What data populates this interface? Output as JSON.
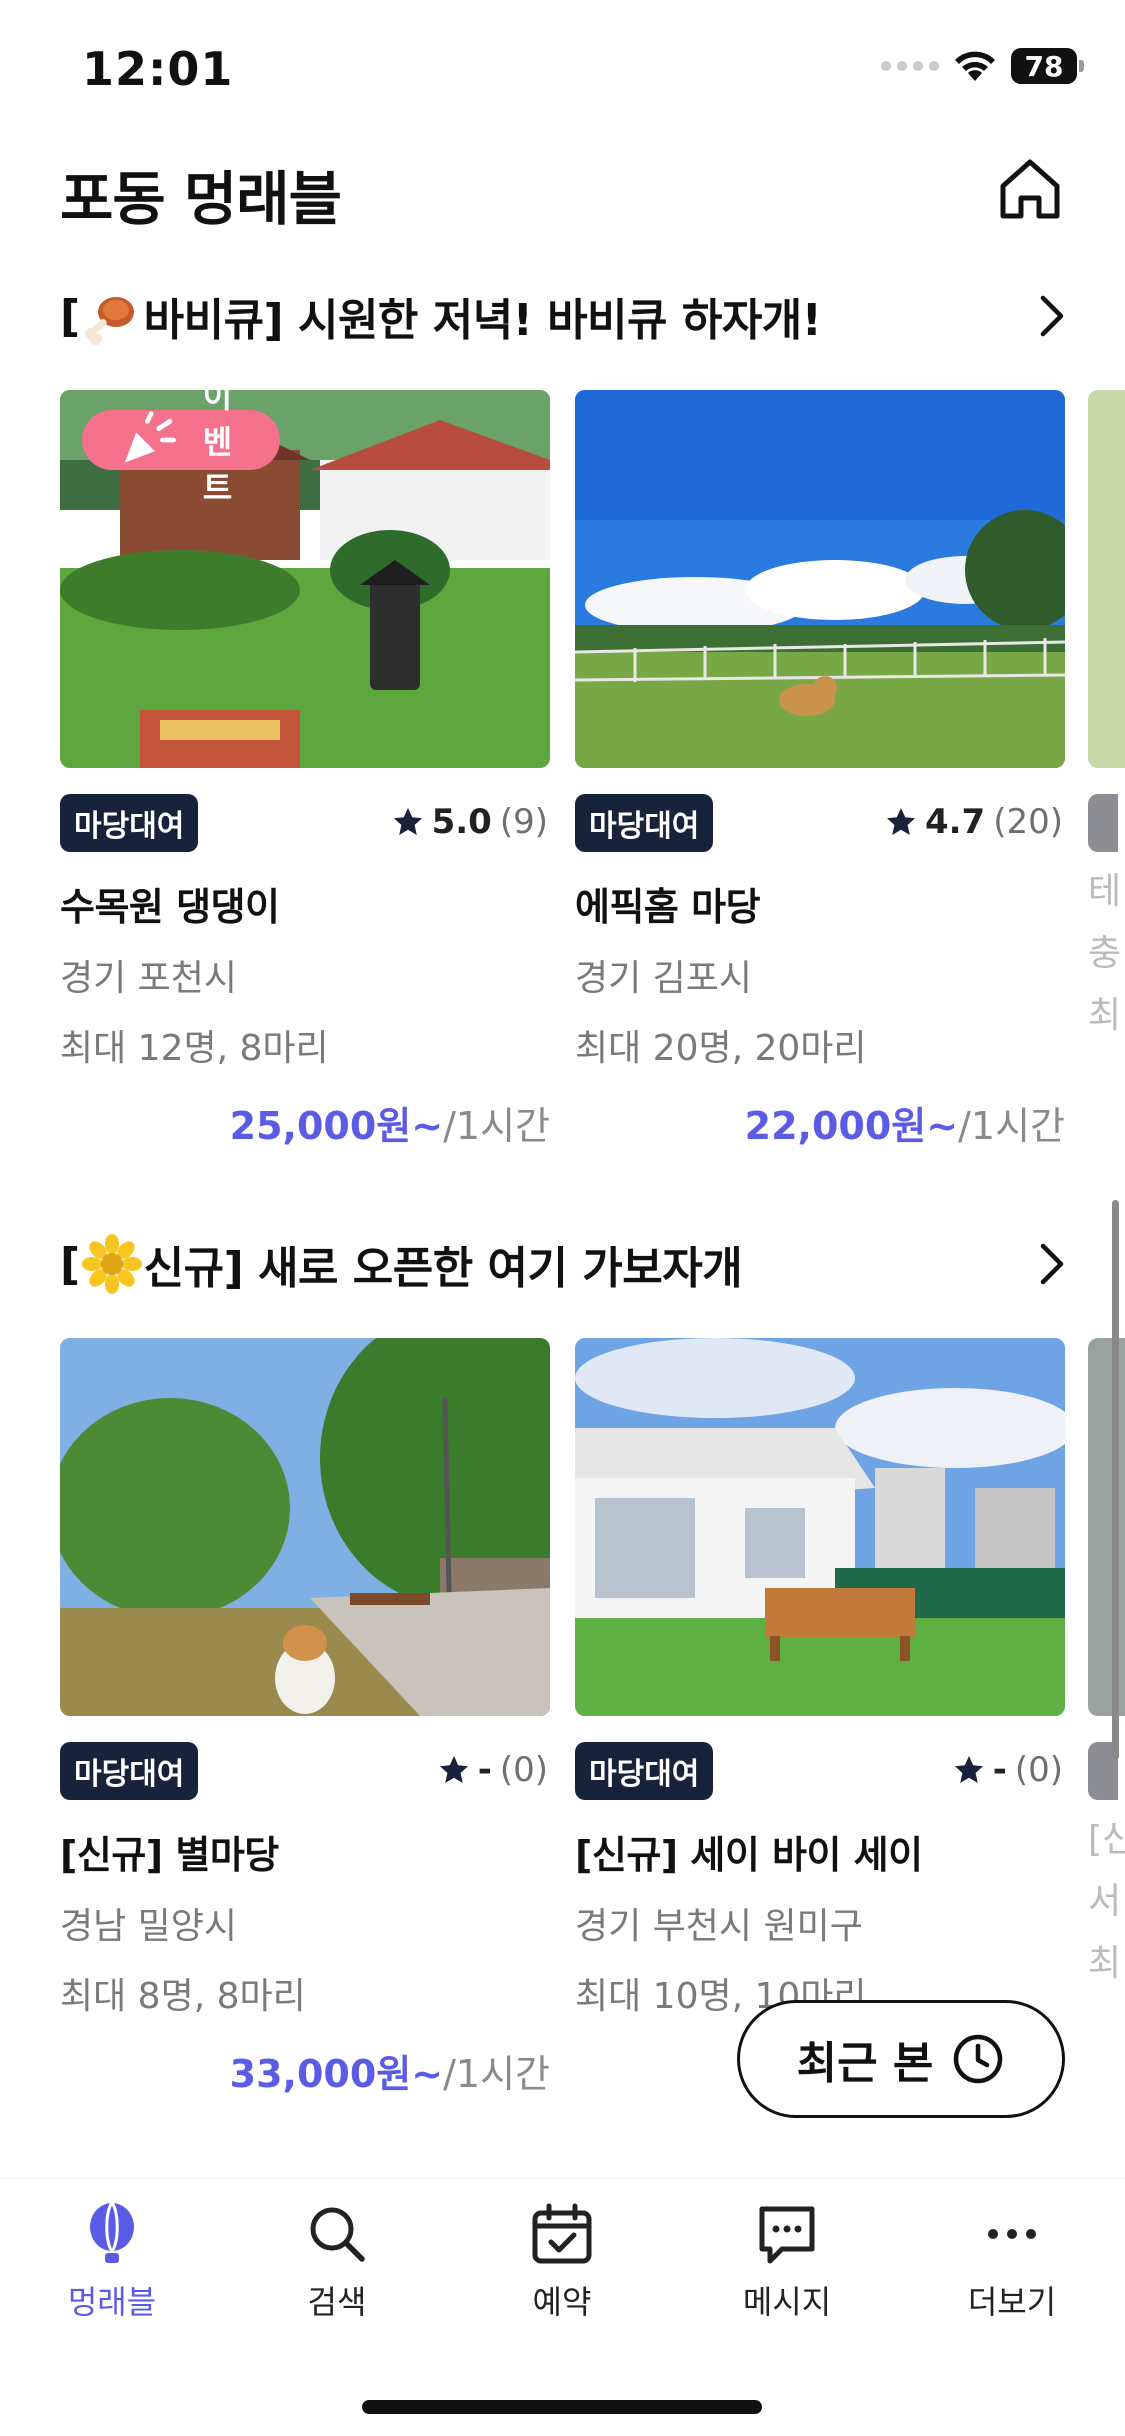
{
  "status_bar": {
    "time": "12:01",
    "battery": "78"
  },
  "header": {
    "title": "포동 멍래블"
  },
  "sections": [
    {
      "title_prefix": "[",
      "title_text": "바비큐] 시원한 저녁! 바비큐 하자개!",
      "emoji_icon": "meat-on-bone-icon",
      "cards": [
        {
          "badge": "이벤트",
          "tag": "마당대여",
          "rating": "5.0",
          "review_count": "(9)",
          "name": "수목원 댕댕이",
          "location": "경기 포천시",
          "capacity": "최대 12명, 8마리",
          "price": "25,000원~",
          "price_unit": "/1시간"
        },
        {
          "tag": "마당대여",
          "rating": "4.7",
          "review_count": "(20)",
          "name": "에픽홈 마당",
          "location": "경기 김포시",
          "capacity": "최대 20명, 20마리",
          "price": "22,000원~",
          "price_unit": "/1시간"
        }
      ],
      "peek": {
        "name": "테",
        "location": "충",
        "capacity": "최"
      }
    },
    {
      "title_prefix": "[",
      "title_text": "신규] 새로 오픈한 여기 가보자개",
      "emoji_icon": "sunflower-icon",
      "cards": [
        {
          "tag": "마당대여",
          "rating": "-",
          "review_count": "(0)",
          "name": "[신규] 별마당",
          "location": "경남 밀양시",
          "capacity": "최대 8명, 8마리",
          "price": "33,000원~",
          "price_unit": "/1시간"
        },
        {
          "tag": "마당대여",
          "rating": "-",
          "review_count": "(0)",
          "name": "[신규] 세이 바이 세이",
          "location": "경기 부천시 원미구",
          "capacity": "최대 10명, 10마리"
        }
      ],
      "peek": {
        "name": "[신",
        "location": "서",
        "capacity": "최"
      }
    }
  ],
  "recent_button": {
    "label": "최근 본"
  },
  "bottom_nav": [
    {
      "label": "멍래블",
      "icon": "balloon-icon",
      "active": true
    },
    {
      "label": "검색",
      "icon": "search-icon"
    },
    {
      "label": "예약",
      "icon": "calendar-check-icon"
    },
    {
      "label": "메시지",
      "icon": "message-icon"
    },
    {
      "label": "더보기",
      "icon": "more-icon"
    }
  ],
  "colors": {
    "accent": "#5b5ce6",
    "tag_bg": "#17223b",
    "event_badge": "#f5728c"
  }
}
